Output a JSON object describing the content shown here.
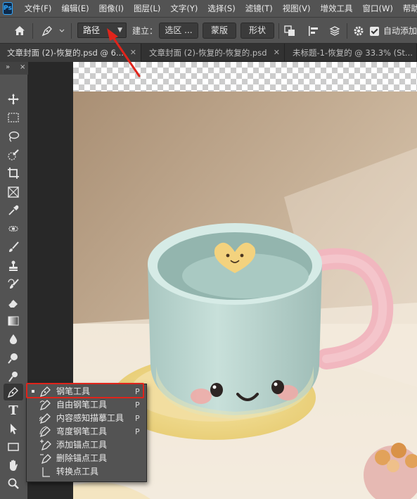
{
  "app": {
    "logo_text": "Ps"
  },
  "menubar": {
    "items": [
      "文件(F)",
      "编辑(E)",
      "图像(I)",
      "图层(L)",
      "文字(Y)",
      "选择(S)",
      "滤镜(T)",
      "视图(V)",
      "增效工具",
      "窗口(W)",
      "帮助(H)"
    ]
  },
  "options": {
    "home_icon": "home-icon",
    "pen_icon": "pen-icon",
    "mode_value": "路径",
    "build_label": "建立：",
    "selection_button": "选区 ...",
    "mask_button": "蒙版",
    "shape_button": "形状",
    "auto_add_label": "自动添加",
    "auto_add_checked": true
  },
  "tabs": [
    {
      "label": "文章封面 (2)-恢复的.psd @ 6...",
      "active": true
    },
    {
      "label": "文章封面 (2)-恢复的-恢复的.psd",
      "active": false
    },
    {
      "label": "未标题-1-恢复的 @ 33.3% (St...",
      "active": false
    }
  ],
  "toolbar": {
    "collapse_glyph": "»",
    "close_glyph": "×",
    "tools": [
      "move-tool",
      "marquee-tool",
      "lasso-tool",
      "quick-select-tool",
      "crop-tool",
      "frame-tool",
      "eyedropper-tool",
      "healing-tool",
      "brush-tool",
      "stamp-tool",
      "history-brush-tool",
      "eraser-tool",
      "gradient-tool",
      "blur-tool",
      "dodge-tool",
      "smudge-tool",
      "pen-tool",
      "type-tool",
      "path-select-tool",
      "rectangle-tool",
      "hand-tool",
      "zoom-tool"
    ],
    "type_glyph": "T"
  },
  "flyout": {
    "items": [
      {
        "label": "钢笔工具",
        "shortcut": "P",
        "selected": true
      },
      {
        "label": "自由钢笔工具",
        "shortcut": "P",
        "selected": false
      },
      {
        "label": "内容感知描摹工具",
        "shortcut": "P",
        "selected": false
      },
      {
        "label": "弯度钢笔工具",
        "shortcut": "P",
        "selected": false
      },
      {
        "label": "添加锚点工具",
        "shortcut": "",
        "selected": false
      },
      {
        "label": "删除锚点工具",
        "shortcut": "",
        "selected": false
      },
      {
        "label": "转换点工具",
        "shortcut": "",
        "selected": false
      }
    ]
  },
  "colors": {
    "ui_dark": "#535353",
    "canvas_bg": "#282828",
    "annotation_red": "#e0241b",
    "ps_blue": "#31a8ff"
  }
}
